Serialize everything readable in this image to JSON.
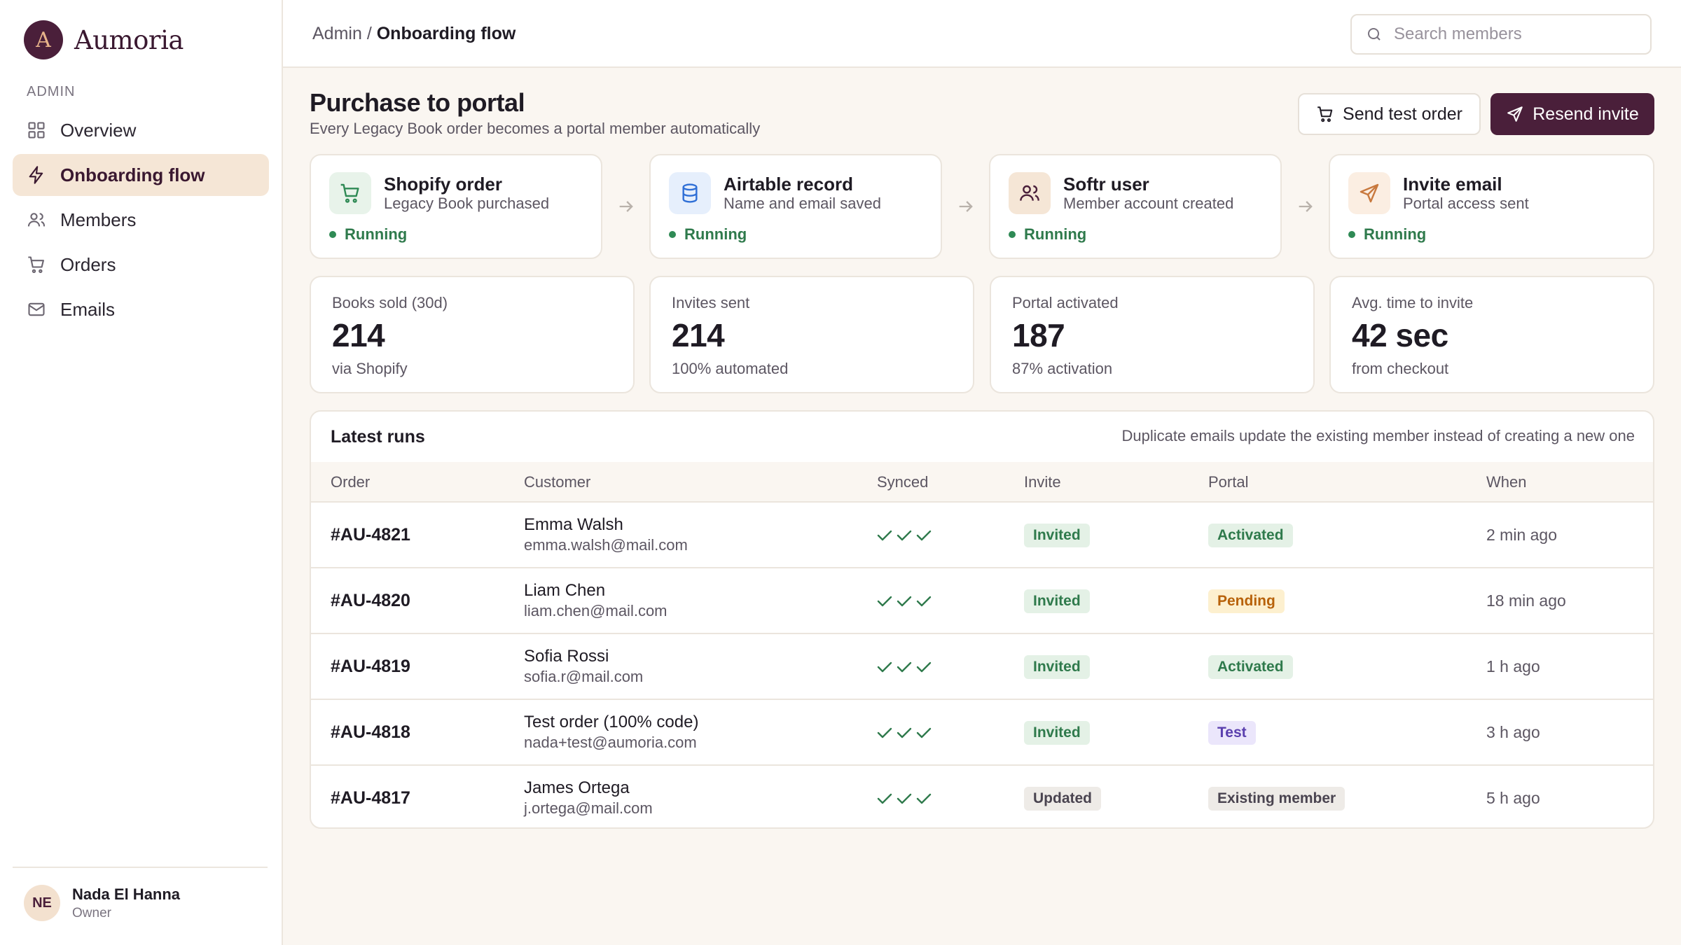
{
  "brand": {
    "initial": "A",
    "name": "Aumoria"
  },
  "sidebar": {
    "section_label": "ADMIN",
    "items": [
      {
        "label": "Overview",
        "icon": "grid-icon"
      },
      {
        "label": "Onboarding flow",
        "icon": "lightning-icon",
        "active": true
      },
      {
        "label": "Members",
        "icon": "users-icon"
      },
      {
        "label": "Orders",
        "icon": "cart-icon"
      },
      {
        "label": "Emails",
        "icon": "mail-icon"
      }
    ],
    "user": {
      "initials": "NE",
      "name": "Nada El Hanna",
      "role": "Owner"
    }
  },
  "topbar": {
    "breadcrumb_parent": "Admin",
    "breadcrumb_sep": "/",
    "breadcrumb_current": "Onboarding flow",
    "search_placeholder": "Search members",
    "search_value": ""
  },
  "header": {
    "title": "Purchase to portal",
    "subtitle": "Every Legacy Book order becomes a portal member automatically",
    "send_test_label": "Send test order",
    "resend_label": "Resend invite"
  },
  "flow": [
    {
      "title": "Shopify order",
      "desc": "Legacy Book purchased",
      "status": "Running",
      "icon": "cart-icon"
    },
    {
      "title": "Airtable record",
      "desc": "Name and email saved",
      "status": "Running",
      "icon": "database-icon"
    },
    {
      "title": "Softr user",
      "desc": "Member account created",
      "status": "Running",
      "icon": "users-icon"
    },
    {
      "title": "Invite email",
      "desc": "Portal access sent",
      "status": "Running",
      "icon": "send-icon"
    }
  ],
  "stats": [
    {
      "label": "Books sold (30d)",
      "value": "214",
      "sub": "via Shopify"
    },
    {
      "label": "Invites sent",
      "value": "214",
      "sub": "100% automated"
    },
    {
      "label": "Portal activated",
      "value": "187",
      "sub": "87% activation"
    },
    {
      "label": "Avg. time to invite",
      "value": "42 sec",
      "sub": "from checkout"
    }
  ],
  "runs": {
    "title": "Latest runs",
    "note": "Duplicate emails update the existing member instead of creating a new one",
    "columns": [
      "Order",
      "Customer",
      "Synced",
      "Invite",
      "Portal",
      "When"
    ],
    "rows": [
      {
        "order": "#AU-4821",
        "name": "Emma Walsh",
        "email": "emma.walsh@mail.com",
        "invite": "Invited",
        "portal": "Activated",
        "portal_tone": "green",
        "when": "2 min ago"
      },
      {
        "order": "#AU-4820",
        "name": "Liam Chen",
        "email": "liam.chen@mail.com",
        "invite": "Invited",
        "portal": "Pending",
        "portal_tone": "amber",
        "when": "18 min ago"
      },
      {
        "order": "#AU-4819",
        "name": "Sofia Rossi",
        "email": "sofia.r@mail.com",
        "invite": "Invited",
        "portal": "Activated",
        "portal_tone": "green",
        "when": "1 h ago"
      },
      {
        "order": "#AU-4818",
        "name": "Test order (100% code)",
        "email": "nada+test@aumoria.com",
        "invite": "Invited",
        "portal": "Test",
        "portal_tone": "purple",
        "when": "3 h ago"
      },
      {
        "order": "#AU-4817",
        "name": "James Ortega",
        "email": "j.ortega@mail.com",
        "invite": "Updated",
        "invite_tone": "gray",
        "portal": "Existing member",
        "portal_tone": "gray",
        "when": "5 h ago"
      }
    ]
  },
  "colors": {
    "brand": "#4a1f3a",
    "accent_soft": "#f5e6d6",
    "success": "#2f7a4c",
    "warning": "#b8620a",
    "test": "#5a3fae"
  }
}
